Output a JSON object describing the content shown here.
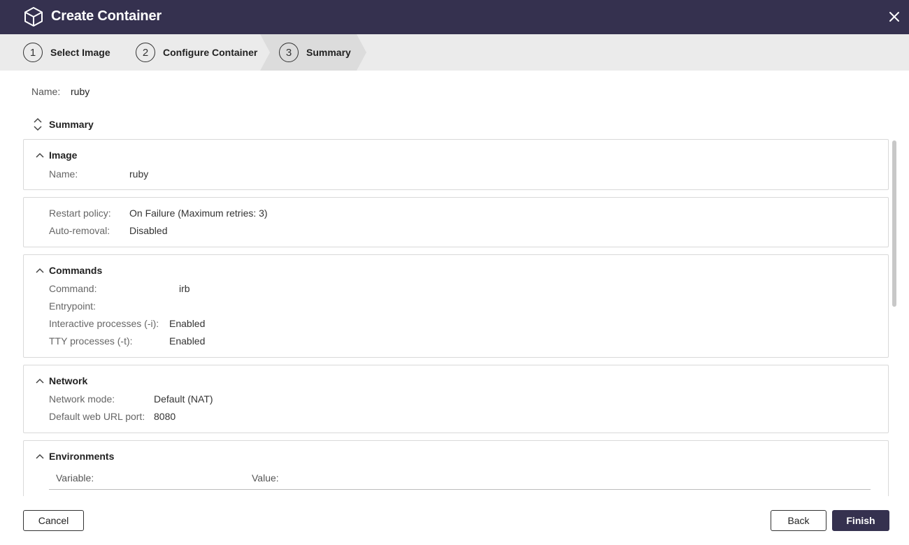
{
  "window": {
    "title": "Create Container"
  },
  "steps": [
    {
      "num": "1",
      "label": "Select Image"
    },
    {
      "num": "2",
      "label": "Configure Container"
    },
    {
      "num": "3",
      "label": "Summary"
    }
  ],
  "name_row": {
    "label": "Name:",
    "value": "ruby"
  },
  "summary_toggle": {
    "label": "Summary"
  },
  "sections": {
    "image": {
      "title": "Image",
      "name_label": "Name:",
      "name_value": "ruby"
    },
    "policy": {
      "restart_label": "Restart policy:",
      "restart_value": "On Failure (Maximum retries: 3)",
      "autoremoval_label": "Auto-removal:",
      "autoremoval_value": "Disabled"
    },
    "commands": {
      "title": "Commands",
      "command_label": "Command:",
      "command_value": "irb",
      "entrypoint_label": "Entrypoint:",
      "entrypoint_value": "",
      "interactive_label": "Interactive processes (-i):",
      "interactive_value": "Enabled",
      "tty_label": "TTY processes (-t):",
      "tty_value": "Enabled"
    },
    "network": {
      "title": "Network",
      "mode_label": "Network mode:",
      "mode_value": "Default (NAT)",
      "port_label": "Default web URL port:",
      "port_value": "8080"
    },
    "environments": {
      "title": "Environments",
      "col_variable": "Variable:",
      "col_value": "Value:"
    }
  },
  "footer": {
    "cancel": "Cancel",
    "back": "Back",
    "finish": "Finish"
  },
  "colors": {
    "titlebar": "#35314f",
    "steps_bg": "#ebebeb",
    "active_step": "#dcdcdc",
    "primary_button": "#35314f"
  }
}
